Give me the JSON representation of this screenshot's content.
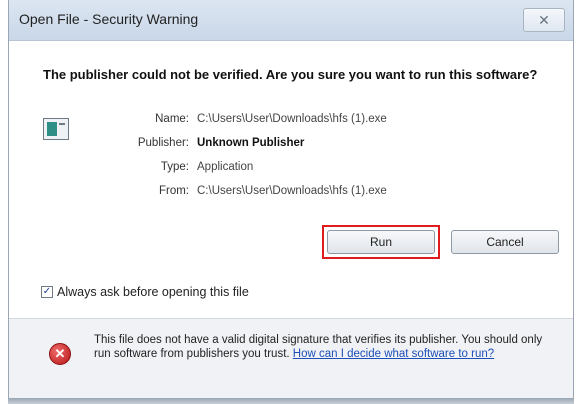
{
  "window": {
    "title": "Open File - Security Warning",
    "close_glyph": "✕"
  },
  "dialog": {
    "headline": "The publisher could not be verified.  Are you sure you want to run this software?",
    "file_icon": "application-file-icon",
    "fields": [
      {
        "label": "Name:",
        "value": "C:\\Users\\User\\Downloads\\hfs (1).exe",
        "bold": false
      },
      {
        "label": "Publisher:",
        "value": "Unknown Publisher",
        "bold": true
      },
      {
        "label": "Type:",
        "value": "Application",
        "bold": false
      },
      {
        "label": "From:",
        "value": "C:\\Users\\User\\Downloads\\hfs (1).exe",
        "bold": false
      }
    ],
    "run_label": "Run",
    "cancel_label": "Cancel",
    "highlight_color": "#e01b1b"
  },
  "checkbox": {
    "label": "Always ask before opening this file",
    "checked": true,
    "check_glyph": "✓"
  },
  "footer": {
    "icon": "shield-x-icon",
    "icon_glyph": "✕",
    "warning_text": "This file does not have a valid digital signature that verifies its publisher. You should only run software from publishers you trust. ",
    "link_text": "How can I decide what software to run?"
  }
}
